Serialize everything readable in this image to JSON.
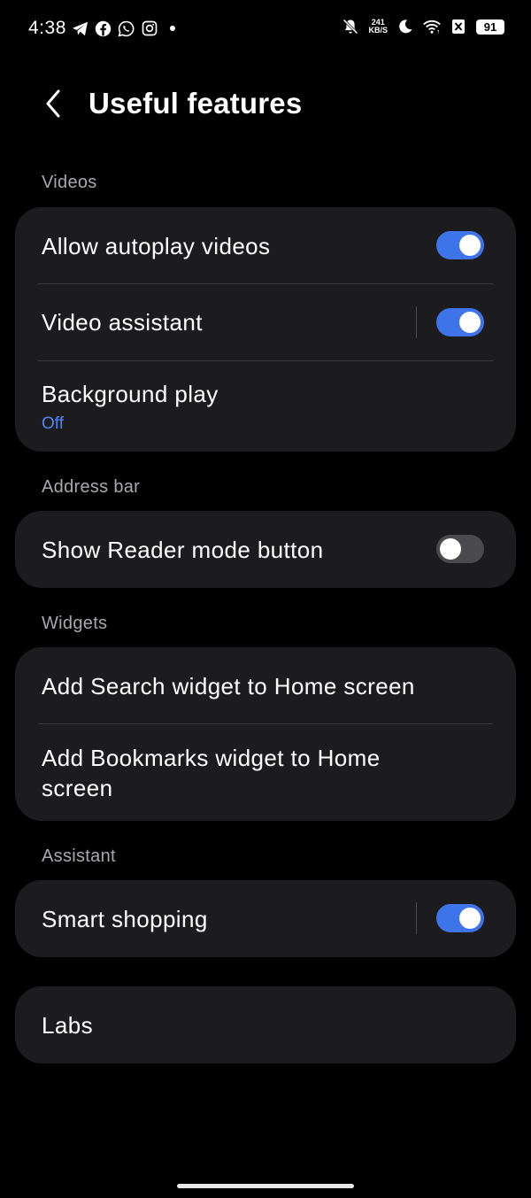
{
  "status_bar": {
    "time": "4:38",
    "notification_icons": [
      "telegram-icon",
      "facebook-icon",
      "whatsapp-icon",
      "instagram-icon",
      "dot-icon"
    ],
    "net_speed_value": "241",
    "net_speed_unit": "KB/S",
    "battery": "91"
  },
  "header": {
    "back_icon": "chevron-left-icon",
    "title": "Useful features"
  },
  "sections": {
    "videos": {
      "label": "Videos",
      "allow_autoplay": {
        "label": "Allow autoplay videos",
        "enabled": true
      },
      "video_assistant": {
        "label": "Video assistant",
        "enabled": true
      },
      "background_play": {
        "label": "Background play",
        "value": "Off"
      }
    },
    "address_bar": {
      "label": "Address bar",
      "reader_mode": {
        "label": "Show Reader mode button",
        "enabled": false
      }
    },
    "widgets": {
      "label": "Widgets",
      "search_widget": {
        "label": "Add Search widget to Home screen"
      },
      "bookmarks_widget": {
        "label_line1": "Add Bookmarks widget to Home",
        "label_line2": "screen"
      }
    },
    "assistant": {
      "label": "Assistant",
      "smart_shopping": {
        "label": "Smart shopping",
        "enabled": true
      }
    },
    "labs": {
      "label": "Labs"
    }
  },
  "colors": {
    "background": "#000000",
    "card": "#1c1c1e",
    "accent": "#3e74ea",
    "sub_text": "#4f86f7",
    "section_label": "#a9a9ad"
  }
}
